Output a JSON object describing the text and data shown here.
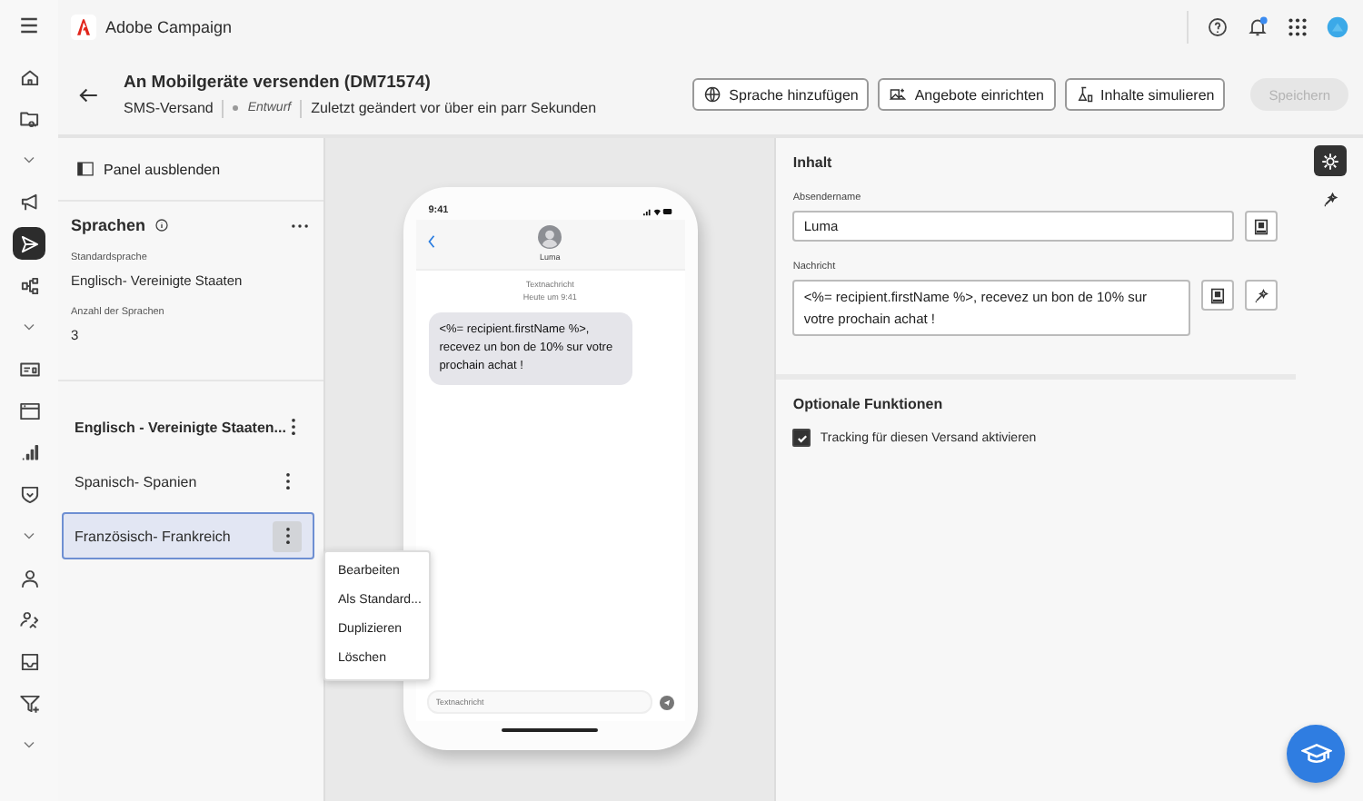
{
  "app": {
    "name": "Adobe Campaign"
  },
  "nav": [
    {
      "kind": "home",
      "selected": false
    },
    {
      "kind": "folder",
      "selected": false
    },
    {
      "kind": "chevron",
      "selected": false
    },
    {
      "kind": "megaphone",
      "selected": false
    },
    {
      "kind": "send",
      "selected": true
    },
    {
      "kind": "workflow",
      "selected": false
    },
    {
      "kind": "chevron",
      "selected": false
    },
    {
      "kind": "card",
      "selected": false
    },
    {
      "kind": "window",
      "selected": false
    },
    {
      "kind": "chart",
      "selected": false
    },
    {
      "kind": "shield",
      "selected": false
    },
    {
      "kind": "chevron",
      "selected": false
    },
    {
      "kind": "person",
      "selected": false
    },
    {
      "kind": "people",
      "selected": false
    },
    {
      "kind": "inbox",
      "selected": false
    },
    {
      "kind": "filter",
      "selected": false
    },
    {
      "kind": "chevron",
      "selected": false
    }
  ],
  "header": {
    "title": "An Mobilgeräte versenden (DM71574)",
    "channel": "SMS-Versand",
    "status": "Entwurf",
    "modified": "Zuletzt geändert vor über ein parr Sekunden",
    "actions": [
      {
        "kind": "globe",
        "label": "Sprache hinzufügen"
      },
      {
        "kind": "offer",
        "label": "Angebote einrichten"
      },
      {
        "kind": "flask",
        "label": "Inhalte simulieren"
      }
    ],
    "save": {
      "label": "Speichern",
      "disabled": true
    }
  },
  "languages_panel": {
    "toggle": "Panel ausblenden",
    "title": "Sprachen",
    "default_label": "Standardsprache",
    "default_value": "Englisch- Vereinigte Staaten",
    "count_label": "Anzahl der Sprachen",
    "count_value": "3",
    "items": [
      {
        "label": "Englisch - Vereinigte Staaten...",
        "bold": true,
        "selected": false
      },
      {
        "label": "Spanisch- Spanien",
        "bold": false,
        "selected": false
      },
      {
        "label": "Französisch- Frankreich",
        "bold": false,
        "selected": true
      }
    ],
    "menu": [
      "Bearbeiten",
      "Als Standard...",
      "Duplizieren",
      "Löschen"
    ]
  },
  "preview": {
    "time": "9:41",
    "contact": "Luma",
    "thread_label": "Textnachricht",
    "thread_time": "Heute um 9:41",
    "message": "<%= recipient.firstName %>, recevez un bon de 10% sur votre prochain achat !",
    "input_placeholder": "Textnachricht"
  },
  "content": {
    "title": "Inhalt",
    "sender_label": "Absendername",
    "sender_value": "Luma",
    "message_label": "Nachricht",
    "message_value": "<%= recipient.firstName %>, recevez un bon de 10% sur votre prochain achat !"
  },
  "options": {
    "title": "Optionale Funktionen",
    "tracking": {
      "label": "Tracking für diesen Versand aktivieren",
      "checked": true
    }
  },
  "right_rail": [
    {
      "kind": "gear",
      "selected": true
    },
    {
      "kind": "sparkle",
      "selected": false
    }
  ]
}
